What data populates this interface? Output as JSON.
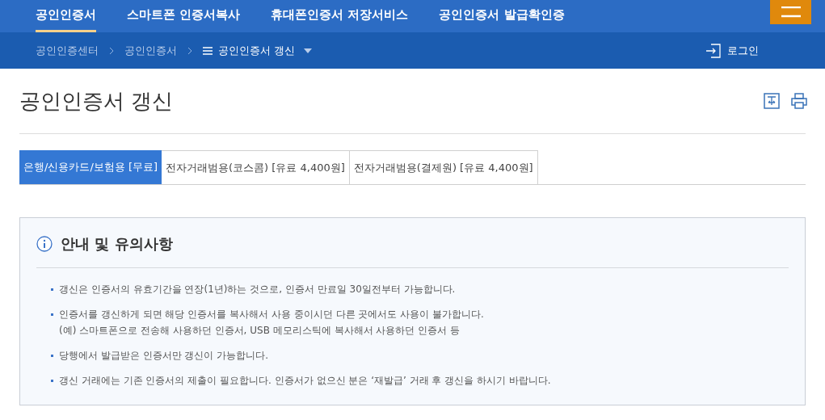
{
  "top_nav": [
    {
      "label": "공인인증서",
      "selected": true
    },
    {
      "label": "스마트폰 인증서복사",
      "selected": false
    },
    {
      "label": "휴대폰인증서 저장서비스",
      "selected": false
    },
    {
      "label": "공인인증서 발급확인증",
      "selected": false
    }
  ],
  "breadcrumb": [
    "공인인증센터",
    "공인인증서",
    "공인인증서 갱신"
  ],
  "login": "로그인",
  "page_title": "공인인증서 갱신",
  "tabs": [
    {
      "label": "은행/신용카드/보험용 [무료]",
      "selected": true
    },
    {
      "label": "전자거래범용(코스콤) [유료 4,400원]",
      "selected": false
    },
    {
      "label": "전자거래범용(결제원) [유료 4,400원]",
      "selected": false
    }
  ],
  "notice": {
    "title": "안내 및 유의사항",
    "items": [
      {
        "lines": [
          "갱신은 인증서의 유효기간을 연장(1년)하는 것으로, 인증서 만료일 30일전부터 가능합니다."
        ]
      },
      {
        "lines": [
          "인증서를 갱신하게 되면 해당 인증서를 복사해서 사용 중이시던 다른 곳에서도 사용이 불가합니다.",
          "(예) 스마트폰으로 전송해 사용하던 인증서, USB 메모리스틱에 복사해서 사용하던 인증서 등"
        ]
      },
      {
        "lines": [
          "당행에서 발급받은 인증서만 갱신이 가능합니다."
        ]
      },
      {
        "lines": [
          "갱신 거래에는 기존 인증서의 제출이 필요합니다. 인증서가 없으신 분은 ‘재발급’ 거래 후 갱신을 하시기 바랍니다."
        ]
      }
    ]
  }
}
